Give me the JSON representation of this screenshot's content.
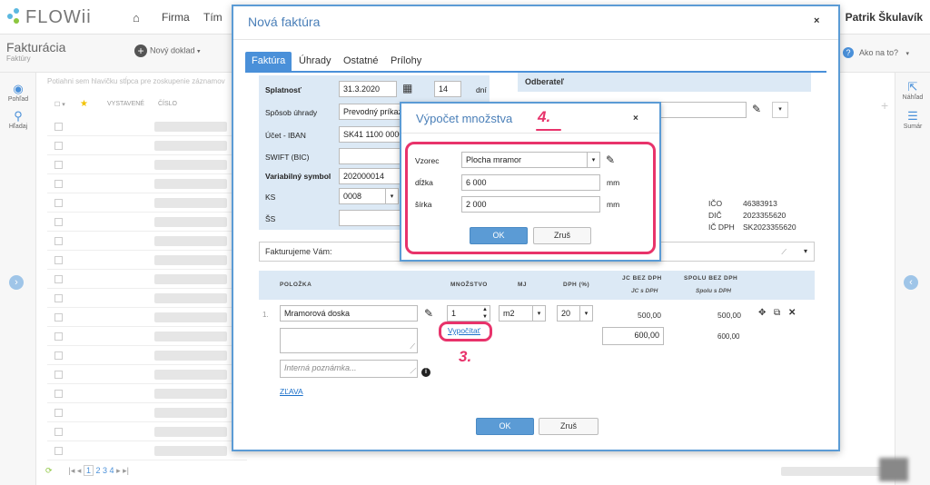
{
  "app": {
    "logo": "FLOWii",
    "nav": [
      "Firma",
      "Tím"
    ],
    "user": "Patrik Škulavík"
  },
  "page": {
    "title": "Fakturácia",
    "subtitle": "Faktúry",
    "new_doc": "Nový doklad",
    "help": "Ako na to?",
    "hint": "Potiahni sem hlavičku stĺpca pre zoskupenie záznamov",
    "left_menu": [
      {
        "label": "Pohľad",
        "icon": "eye-icon"
      },
      {
        "label": "Hľadaj",
        "icon": "search-icon"
      }
    ],
    "right_menu": [
      {
        "label": "Náhľad",
        "icon": "external-link-icon"
      },
      {
        "label": "Sumár",
        "icon": "list-icon"
      }
    ],
    "table_headers": [
      "VYSTAVENÉ",
      "ČÍSLO"
    ],
    "pager": {
      "pages": [
        "1",
        "2",
        "3",
        "4"
      ],
      "current": "1"
    }
  },
  "modal": {
    "title": "Nová faktúra",
    "close": "×",
    "tabs": [
      "Faktúra",
      "Úhrady",
      "Ostatné",
      "Prílohy"
    ],
    "form": {
      "splatnost_label": "Splatnosť",
      "splatnost_value": "31.3.2020",
      "days_value": "14",
      "days_unit": "dní",
      "sposob_label": "Spôsob úhrady",
      "sposob_value": "Prevodný príkaz",
      "ucet_label": "Účet - IBAN",
      "ucet_value": "SK41 1100 0000",
      "swift_label": "SWIFT (BIC)",
      "swift_value": "",
      "vs_label": "Variabilný symbol",
      "vs_value": "202000014",
      "ks_label": "KS",
      "ks_value": "0008",
      "ss_label": "ŠS",
      "ss_value": ""
    },
    "odberatel": {
      "label": "Odberateľ",
      "ico_label": "IČO",
      "ico": "46383913",
      "dic_label": "DIČ",
      "dic": "2023355620",
      "icdph_label": "IČ DPH",
      "icdph": "SK2023355620"
    },
    "fakturujeme": "Fakturujeme Vám:",
    "items_header": {
      "polozka": "POLOŽKA",
      "mnozstvo": "MNOŽSTVO",
      "mj": "MJ",
      "dph": "DPH (%)",
      "jc_bez": "JC BEZ DPH",
      "jc_s": "JC s DPH",
      "spolu_bez": "SPOLU BEZ DPH",
      "spolu_s": "Spolu s DPH"
    },
    "item": {
      "num": "1.",
      "name": "Mramorová doska",
      "qty": "1",
      "mj": "m2",
      "dph": "20",
      "jc_bez": "500,00",
      "spolu_bez": "500,00",
      "jc_s": "600,00",
      "spolu_s": "600,00",
      "vypocitat": "Vypočítať",
      "note_placeholder": "Interná poznámka...",
      "zlava": "ZĽAVA"
    },
    "ok": "OK",
    "cancel": "Zruš"
  },
  "dialog": {
    "title": "Výpočet množstva",
    "close": "×",
    "vzorec_label": "Vzorec",
    "vzorec_value": "Plocha mramor",
    "dlzka_label": "dĺžka",
    "dlzka_value": "6 000",
    "dlzka_unit": "mm",
    "sirka_label": "šírka",
    "sirka_value": "2 000",
    "sirka_unit": "mm",
    "ok": "OK",
    "cancel": "Zruš"
  },
  "annotations": {
    "a4": "4.",
    "a3": "3.",
    "color": "#e8336b"
  }
}
